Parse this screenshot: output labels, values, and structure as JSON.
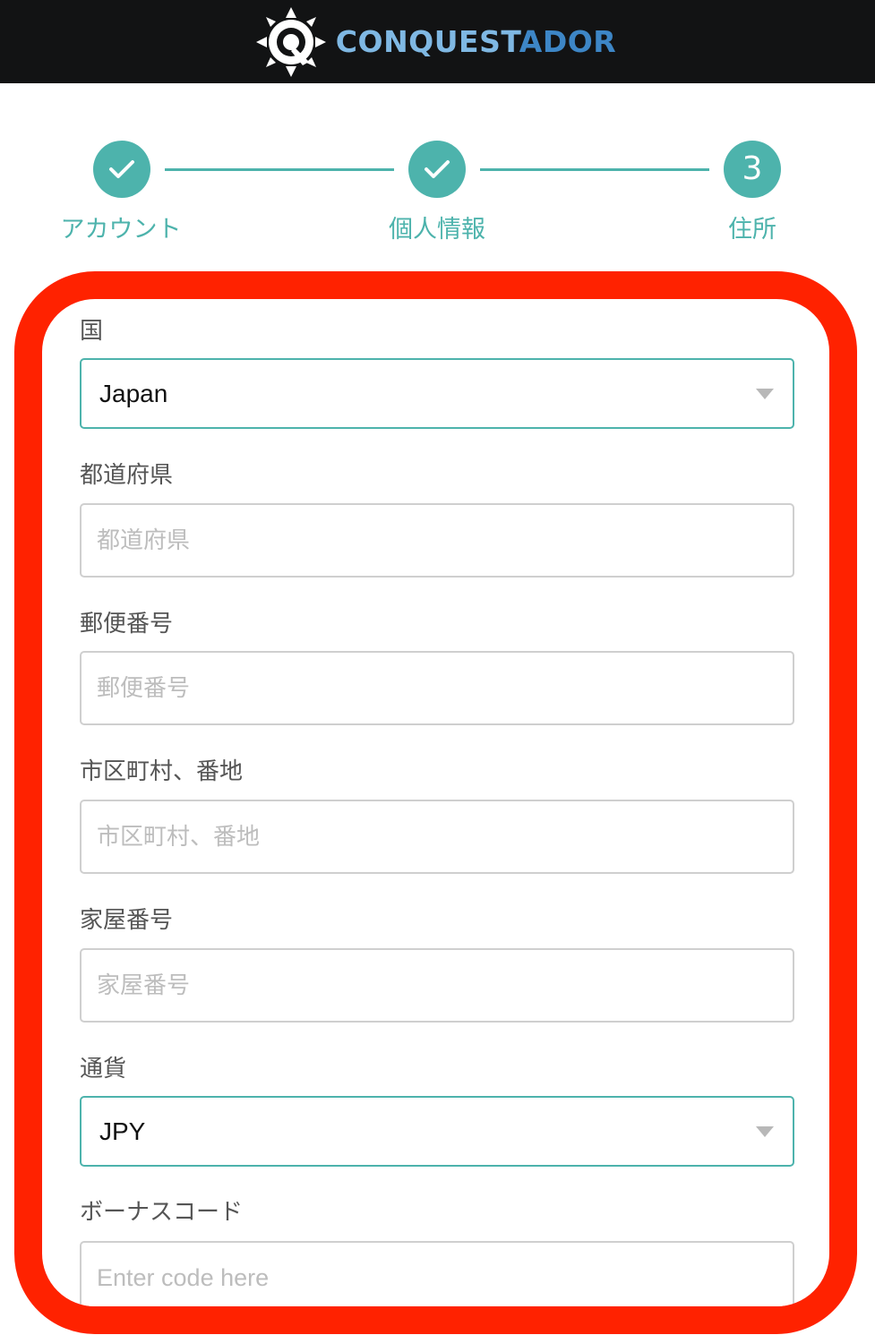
{
  "brand": {
    "name_light": "CONQUEST",
    "name_dark": "ADOR",
    "logo_icon": "compass-q-icon"
  },
  "stepper": {
    "steps": [
      {
        "label": "アカウント",
        "status": "complete",
        "icon": "check-icon"
      },
      {
        "label": "個人情報",
        "status": "complete",
        "icon": "check-icon"
      },
      {
        "label": "住所",
        "status": "current",
        "number": "3"
      }
    ]
  },
  "form": {
    "country": {
      "label": "国",
      "value": "Japan"
    },
    "prefecture": {
      "label": "都道府県",
      "placeholder": "都道府県"
    },
    "postal_code": {
      "label": "郵便番号",
      "placeholder": "郵便番号"
    },
    "city_address": {
      "label": "市区町村、番地",
      "placeholder": "市区町村、番地"
    },
    "house_number": {
      "label": "家屋番号",
      "placeholder": "家屋番号"
    },
    "currency": {
      "label": "通貨",
      "value": "JPY"
    },
    "bonus_code": {
      "label": "ボーナスコード",
      "placeholder": "Enter code here"
    }
  },
  "colors": {
    "header_bg": "#121314",
    "accent_teal": "#4db3ac",
    "brand_light_blue": "#7fb8e3",
    "brand_dark_blue": "#3d86c6",
    "highlight_frame": "#ff2200"
  }
}
